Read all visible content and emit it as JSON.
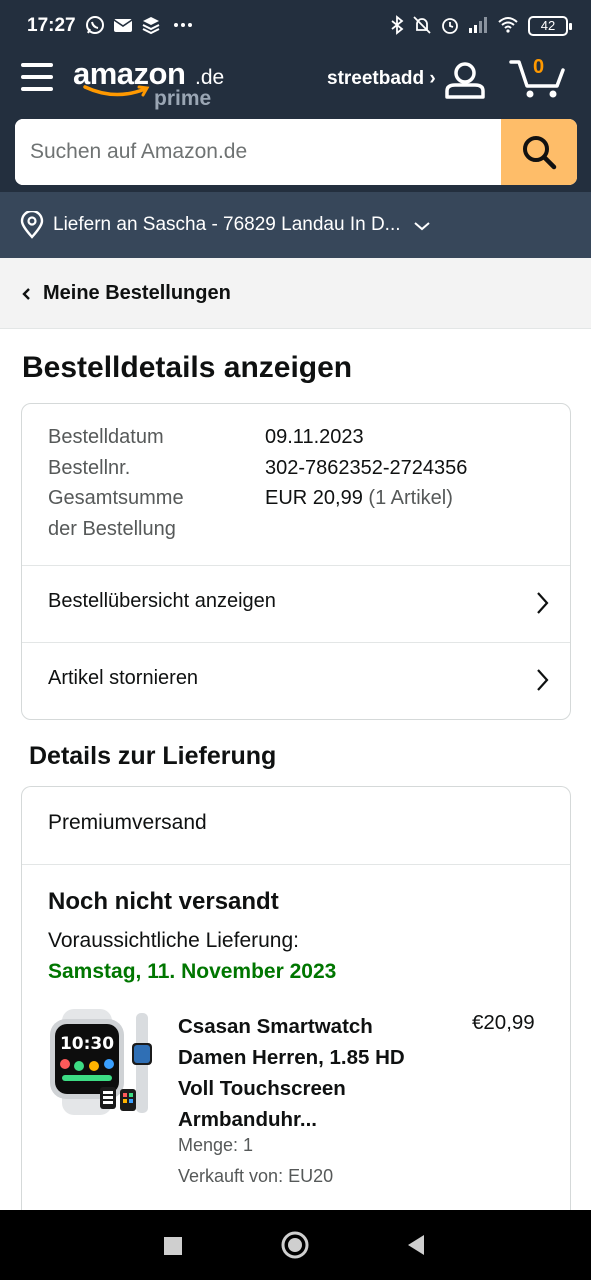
{
  "status_bar": {
    "time": "17:27",
    "battery": "42"
  },
  "header": {
    "logo_word": "amazon",
    "logo_tld": ".de",
    "logo_sub": "prime",
    "account_label": "streetbadd ›",
    "cart_count": "0"
  },
  "search": {
    "placeholder": "Suchen auf Amazon.de"
  },
  "delivery_location": "Liefern an Sascha - 76829 Landau In D...",
  "breadcrumb": "Meine Bestellungen",
  "page_title": "Bestelldetails anzeigen",
  "order": {
    "date_label": "Bestelldatum",
    "date_value": "09.11.2023",
    "number_label": "Bestellnr.",
    "number_value": "302-7862352-2724356",
    "total_label_1": "Gesamtsumme",
    "total_label_2": "der Bestellung",
    "total_value": "EUR 20,99",
    "total_items": "(1 Artikel)"
  },
  "links": {
    "overview": "Bestellübersicht anzeigen",
    "cancel": "Artikel stornieren"
  },
  "delivery": {
    "section_title": "Details zur Lieferung",
    "method": "Premiumversand",
    "status": "Noch nicht versandt",
    "estimate_label": "Voraussichtliche Lieferung:",
    "estimate_date": "Samstag, 11. November 2023"
  },
  "product": {
    "name": "Csasan Smartwatch Damen Herren, 1.85 HD Voll Touchscreen Armbanduhr...",
    "price": "€20,99",
    "quantity": "Menge: 1",
    "seller": "Verkauft von: EU20",
    "watch_time": "10:30"
  },
  "colors": {
    "header_bg": "#232f3e",
    "deliver_bg": "#37475a",
    "search_button": "#febd69",
    "delivery_green": "#007600",
    "cart_count": "#ff9900"
  }
}
